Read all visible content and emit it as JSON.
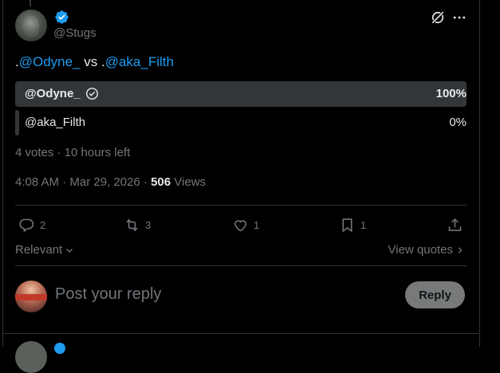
{
  "post": {
    "handle": "@Stugs",
    "text_prefix": ".",
    "mention1": "@Odyne_",
    "text_mid": " vs .",
    "mention2": "@aka_Filth"
  },
  "poll": {
    "options": [
      {
        "label": "@Odyne_",
        "percent_label": "100%",
        "percent": 100,
        "chosen": true
      },
      {
        "label": "@aka_Filth",
        "percent_label": "0%",
        "percent": 0,
        "chosen": false
      }
    ],
    "meta": "4 votes · 10 hours left"
  },
  "timestamp": {
    "time_date": "4:08 AM · Mar 29, 2026 · ",
    "views_count": "506",
    "views_label": " Views"
  },
  "actions": {
    "replies": "2",
    "reposts": "3",
    "likes": "1",
    "bookmarks": "1"
  },
  "sort": {
    "label": "Relevant",
    "view_quotes": "View quotes"
  },
  "reply": {
    "placeholder": "Post your reply",
    "button": "Reply"
  },
  "colors": {
    "accent": "#1d9bf0",
    "muted": "#71767b",
    "border": "#2f3336",
    "poll_bar": "#333639"
  }
}
